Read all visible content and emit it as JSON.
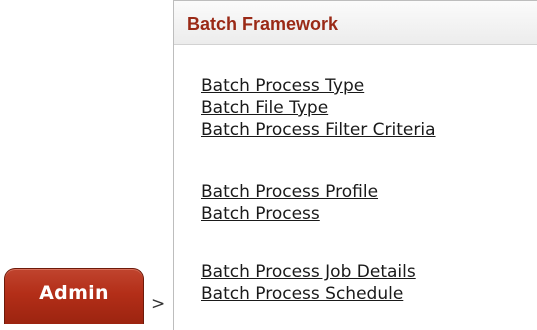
{
  "breadcrumb": {
    "root_label": "Admin",
    "separator": ">"
  },
  "panel": {
    "title": "Batch Framework",
    "groups": [
      {
        "links": [
          "Batch Process Type",
          "Batch File Type",
          "Batch Process Filter Criteria"
        ]
      },
      {
        "links": [
          "Batch Process Profile",
          "Batch Process"
        ]
      },
      {
        "links": [
          "Batch Process Job Details",
          "Batch Process Schedule"
        ]
      }
    ]
  },
  "colors": {
    "tab_red": "#b32e18",
    "title_red": "#9a2a17",
    "link_text": "#1a1a1a"
  }
}
